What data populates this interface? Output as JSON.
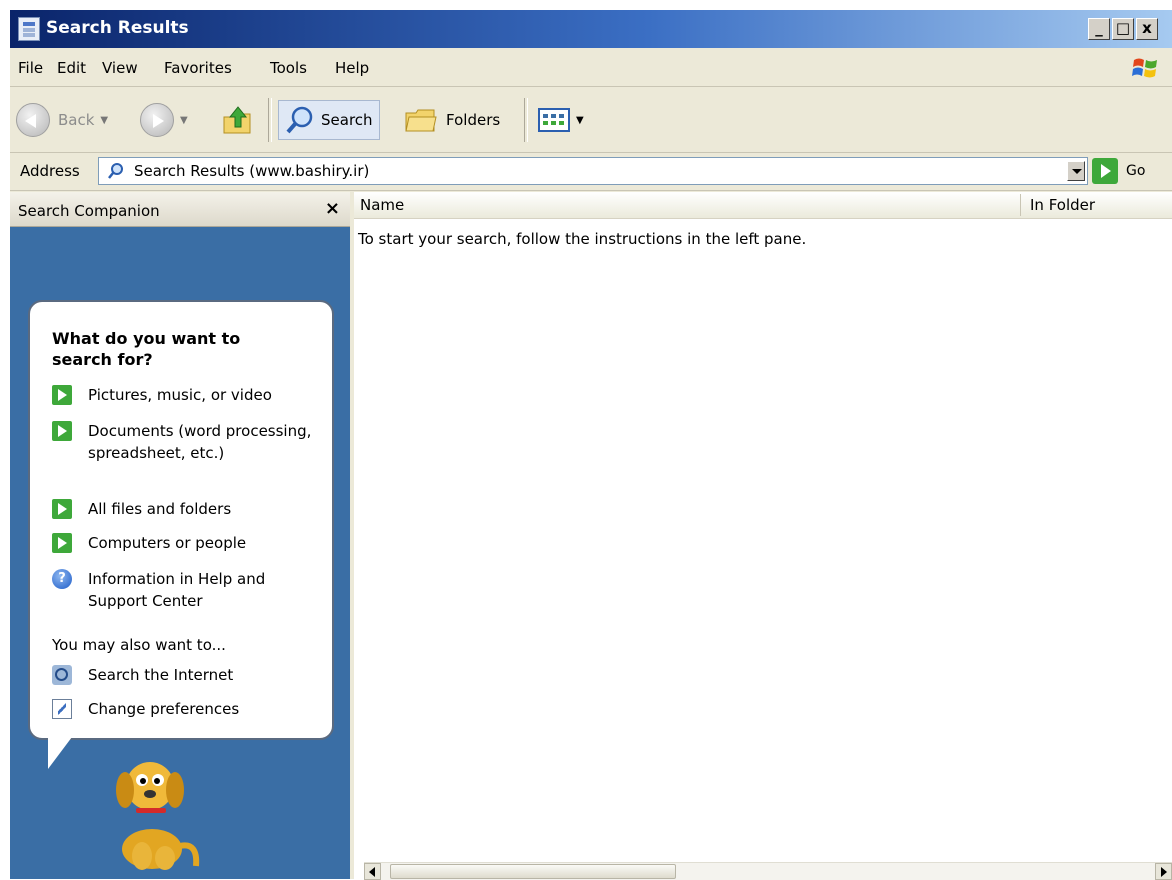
{
  "window": {
    "title": "Search Results",
    "controls": {
      "minimize": "_",
      "maximize": "□",
      "close": "x"
    }
  },
  "menu": {
    "items": [
      {
        "label": "File",
        "key": "F"
      },
      {
        "label": "Edit",
        "key": "E"
      },
      {
        "label": "View",
        "key": "V"
      },
      {
        "label": "Favorites",
        "key": "a"
      },
      {
        "label": "Tools",
        "key": "T"
      },
      {
        "label": "Help",
        "key": "H"
      }
    ]
  },
  "toolbar": {
    "back_label": "Back",
    "search_label": "Search",
    "folders_label": "Folders"
  },
  "address": {
    "label": "Address",
    "value": "Search Results (www.bashiry.ir)",
    "go_label": "Go"
  },
  "search_companion": {
    "title": "Search Companion",
    "close": "×",
    "question": "What do you want to search for?",
    "options": [
      {
        "label": "Pictures, music, or video",
        "icon": "green-arrow-icon"
      },
      {
        "label": "Documents (word processing, spreadsheet, etc.)",
        "icon": "green-arrow-icon"
      },
      {
        "label": "All files and folders",
        "icon": "green-arrow-icon"
      },
      {
        "label": "Computers or people",
        "icon": "green-arrow-icon"
      },
      {
        "label": "Information in Help and Support Center",
        "icon": "help-icon"
      }
    ],
    "also_label": "You may also want to...",
    "also_options": [
      {
        "label": "Search the Internet",
        "icon": "search-internet-icon"
      },
      {
        "label": "Change preferences",
        "icon": "preferences-icon"
      }
    ]
  },
  "results": {
    "columns": [
      "Name",
      "In Folder"
    ],
    "instruction": "To start your search, follow the instructions in the left pane."
  },
  "colors": {
    "title_bar": "#0a246a",
    "pane_blue": "#3a6ea5",
    "chrome": "#ece9d8",
    "go_green": "#3ea83a"
  }
}
